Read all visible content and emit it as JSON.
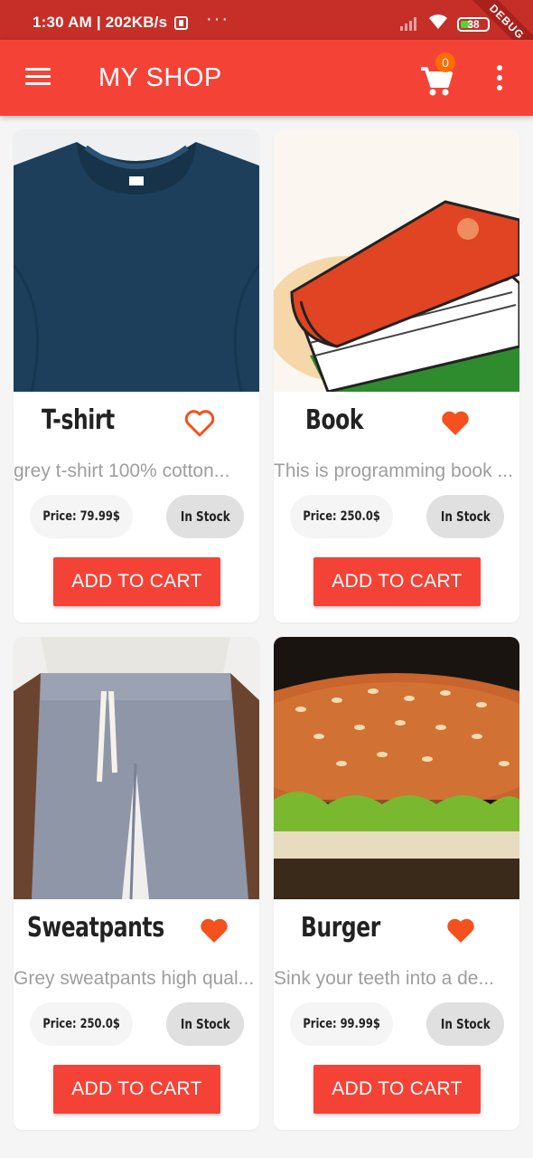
{
  "status_bar": {
    "time": "1:30 AM | 202KB/s",
    "more": "···",
    "battery": "38",
    "debug": "DEBUG"
  },
  "app_bar": {
    "title": "MY SHOP",
    "cart_count": "0"
  },
  "colors": {
    "primary": "#f44336",
    "status_bar": "#c62f28",
    "badge": "#ff6d00",
    "heart": "#f4511e"
  },
  "products": [
    {
      "name": "T-shirt",
      "description": "grey t-shirt  100% cotton...",
      "price": "Price: 79.99$",
      "stock": "In Stock",
      "favorite": false,
      "image": "tshirt-image",
      "button": "ADD TO CART"
    },
    {
      "name": "Book",
      "description": "This is programming book ...",
      "price": "Price: 250.0$",
      "stock": "In Stock",
      "favorite": true,
      "image": "book-image",
      "button": "ADD TO CART"
    },
    {
      "name": "Sweatpants",
      "description": "Grey sweatpants high qual...",
      "price": "Price: 250.0$",
      "stock": "In Stock",
      "favorite": true,
      "image": "sweatpants-image",
      "button": "ADD TO CART"
    },
    {
      "name": "Burger",
      "description": "Sink your teeth into a de...",
      "price": "Price: 99.99$",
      "stock": "In Stock",
      "favorite": true,
      "image": "burger-image",
      "button": "ADD TO CART"
    }
  ]
}
